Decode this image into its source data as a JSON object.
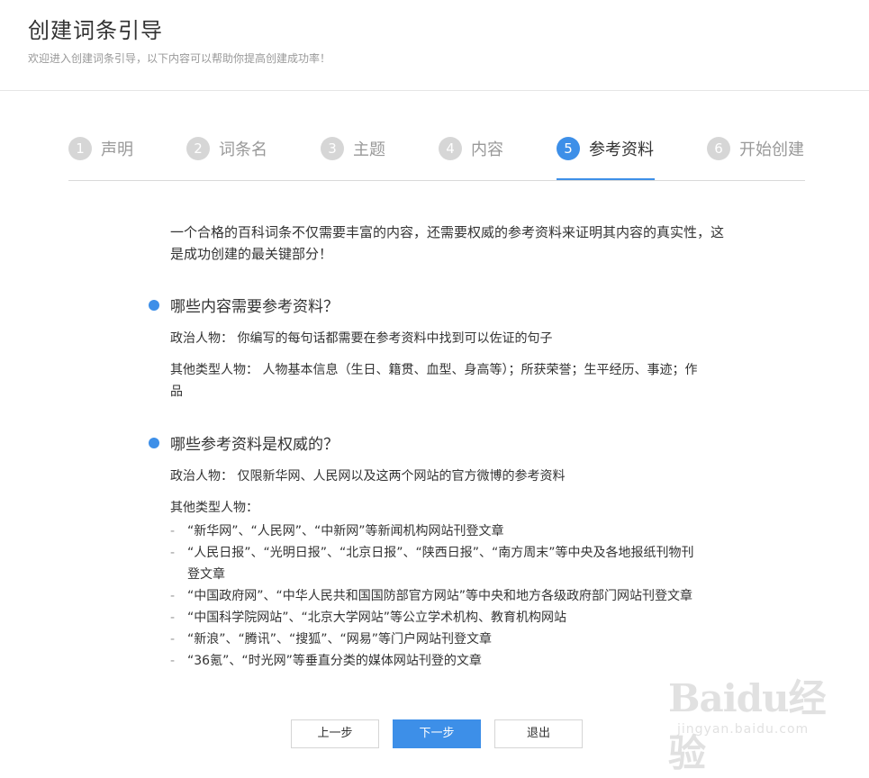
{
  "header": {
    "title": "创建词条引导",
    "subtitle": "欢迎进入创建词条引导，以下内容可以帮助你提高创建成功率！"
  },
  "steps": [
    {
      "num": "1",
      "label": "声明"
    },
    {
      "num": "2",
      "label": "词条名"
    },
    {
      "num": "3",
      "label": "主题"
    },
    {
      "num": "4",
      "label": "内容"
    },
    {
      "num": "5",
      "label": "参考资料"
    },
    {
      "num": "6",
      "label": "开始创建"
    }
  ],
  "active_step": "5",
  "intro": "一个合格的百科词条不仅需要丰富的内容，还需要权威的参考资料来证明其内容的真实性，这是成功创建的最关键部分！",
  "section1": {
    "title": "哪些内容需要参考资料？",
    "politics": "政治人物： 你编写的每句话都需要在参考资料中找到可以佐证的句子",
    "others": "其他类型人物： 人物基本信息（生日、籍贯、血型、身高等）；所获荣誉；生平经历、事迹；作品"
  },
  "section2": {
    "title": "哪些参考资料是权威的？",
    "politics": "政治人物： 仅限新华网、人民网以及这两个网站的官方微博的参考资料",
    "others_label": "其他类型人物：",
    "items": [
      "“新华网”、“人民网”、“中新网”等新闻机构网站刊登文章",
      "“人民日报”、“光明日报”、“北京日报”、“陕西日报”、“南方周末”等中央及各地报纸刊物刊登文章",
      "“中国政府网”、“中华人民共和国国防部官方网站”等中央和地方各级政府部门网站刊登文章",
      "“中国科学院网站”、“北京大学网站”等公立学术机构、教育机构网站",
      "“新浪”、“腾讯”、“搜狐”、“网易”等门户网站刊登文章",
      "“36氪”、“时光网”等垂直分类的媒体网站刊登的文章"
    ]
  },
  "buttons": {
    "prev": "上一步",
    "next": "下一步",
    "exit": "退出"
  },
  "watermark": {
    "brand": "Baidu经验",
    "url": "jingyan.baidu.com"
  },
  "colors": {
    "accent": "#3d8fe8",
    "inactive": "#d6d6d6"
  }
}
